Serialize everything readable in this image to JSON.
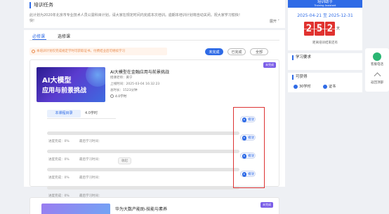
{
  "header": {
    "title": "培训任务",
    "intro": "此计划为2020年北京市专业技术人员公需科目计划，请大家在规定时间内完成本次培训。逾期本培训计划将自动关闭。祝大家学习愉快！",
    "intro_tail": "快!",
    "more": "展开 ˅"
  },
  "tabs": [
    "必修课",
    "选修课"
  ],
  "notice": "本培训计划仅完成规定学时可获取证书，付费结业后可继续学习",
  "filters": [
    "未完成",
    "已完成",
    "全部"
  ],
  "course1": {
    "badge": "未完成",
    "thumb_line1": "AI大模型",
    "thumb_line2": "应用与前景挑战",
    "title": "AI大模型在金融应用与前景挑战",
    "teacher": "授课老师：黄宁",
    "time": "上线时间：2025-03-04 16:32:23",
    "duration": "总时长：1523分钟",
    "hours": "4.0学时",
    "sub_tab": "本课程目录",
    "sub_hours": "4.0学时",
    "rows": [
      {
        "progress": "进度完成：0%",
        "last": "最后学习时间：",
        "play": "播放"
      },
      {
        "progress": "进度完成：0%",
        "last": "最后学习时间：",
        "play": "播放"
      },
      {
        "progress": "进度完成：0%",
        "last": "最后学习时间：",
        "play": "播放"
      },
      {
        "progress": "进度完成：0%",
        "last": "最后学习时间：",
        "play": "播放"
      }
    ],
    "collapse": "收起"
  },
  "course2": {
    "title": "华为大数产能助-技能与素养",
    "badge": "未完成"
  },
  "assistant": {
    "title": "培训助手",
    "subtitle": "Training Assistant",
    "date_range": "2025-04-21 至 2025-12-31",
    "days": [
      "2",
      "5",
      "2"
    ],
    "unit": "天",
    "remain": "距离培训结束还有"
  },
  "side": {
    "requirement": "学习要求",
    "earn_title": "可获得",
    "earn_hours": "30学时",
    "earn_cert": "证书"
  },
  "float": {
    "service": "客服电话",
    "top": "返回顶部"
  }
}
